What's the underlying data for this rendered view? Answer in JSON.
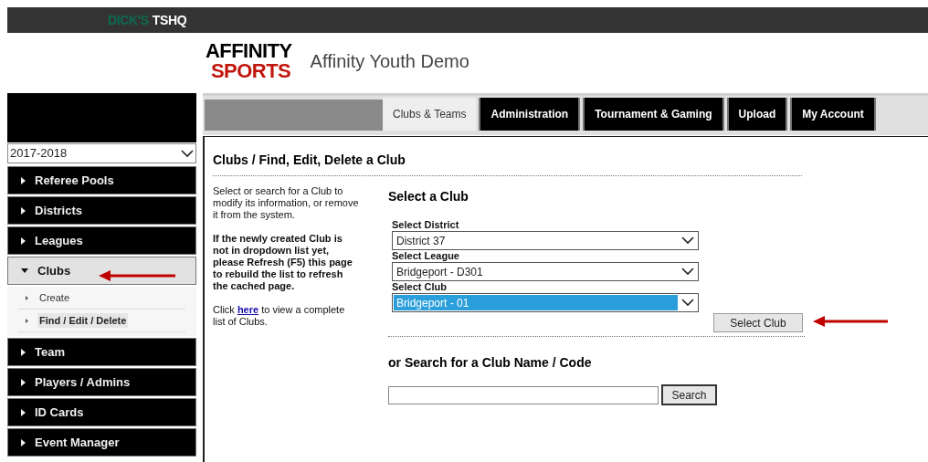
{
  "top_bar": {
    "brand_primary": "DICK'S",
    "brand_secondary": "TSHQ"
  },
  "header": {
    "logo_top": "AFFINITY",
    "logo_bottom": "SPORTS",
    "site_title": "Affinity Youth Demo"
  },
  "sidebar": {
    "season": "2017-2018",
    "items": [
      {
        "label": "Referee Pools",
        "expanded": false
      },
      {
        "label": "Districts",
        "expanded": false
      },
      {
        "label": "Leagues",
        "expanded": false
      },
      {
        "label": "Clubs",
        "expanded": true,
        "children": [
          {
            "label": "Create",
            "selected": false
          },
          {
            "label": "Find / Edit / Delete",
            "selected": true
          }
        ]
      },
      {
        "label": "Team",
        "expanded": false
      },
      {
        "label": "Players / Admins",
        "expanded": false
      },
      {
        "label": "ID Cards",
        "expanded": false
      },
      {
        "label": "Event Manager",
        "expanded": false
      }
    ]
  },
  "tabs": [
    {
      "label": "Clubs & Teams",
      "selected": true
    },
    {
      "label": "Administration",
      "selected": false
    },
    {
      "label": "Tournament & Gaming",
      "selected": false
    },
    {
      "label": "Upload",
      "selected": false
    },
    {
      "label": "My Account",
      "selected": false
    }
  ],
  "page_title": "Clubs / Find, Edit, Delete a Club",
  "help": {
    "intro": "Select or search for a Club to modify its information, or remove it from the system.",
    "notice": "If the newly created Club is not in dropdown list yet, please Refresh (F5) this page to rebuild the list to refresh the cached page.",
    "link_before": "Click",
    "link": "here",
    "link_after": "to view a complete list of Clubs."
  },
  "select_section": {
    "heading": "Select a Club",
    "fields": [
      {
        "label": "Select District",
        "value": "District 37",
        "highlighted": false
      },
      {
        "label": "Select League",
        "value": "Bridgeport - D301",
        "highlighted": false
      },
      {
        "label": "Select Club",
        "value": "Bridgeport - 01",
        "highlighted": true
      }
    ],
    "button": "Select Club"
  },
  "search_section": {
    "heading": "or Search for a Club Name / Code",
    "button": "Search"
  }
}
